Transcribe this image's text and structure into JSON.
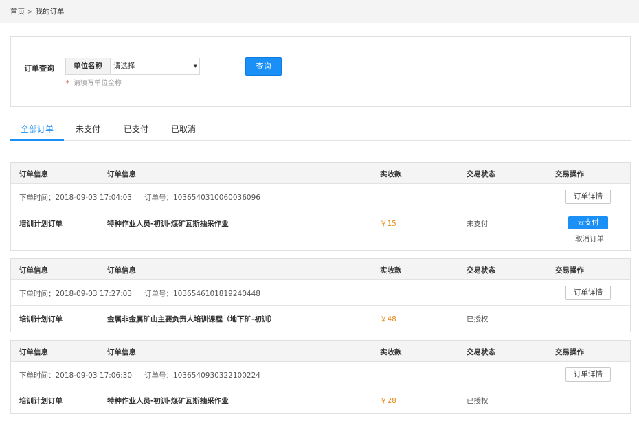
{
  "breadcrumb": {
    "home": "首页",
    "separator": ">",
    "current": "我的订单"
  },
  "search": {
    "label": "订单查询",
    "prefix": "单位名称",
    "select_value": "请选择",
    "hint_star": "*",
    "hint": "请填写单位全称",
    "button": "查询"
  },
  "tabs": [
    "全部订单",
    "未支付",
    "已支付",
    "已取消"
  ],
  "columns": {
    "col1": "订单信息",
    "col2": "订单信息",
    "col3": "实收款",
    "col4": "交易状态",
    "col5": "交易操作"
  },
  "orders": [
    {
      "time_label": "下单时间：2018-09-03 17:04:03",
      "no_label": "订单号：1036540310060036096",
      "detail_button": "订单详情",
      "type": "培训计划订单",
      "name": "特种作业人员-初训-煤矿瓦斯抽采作业",
      "price": "￥15",
      "status": "未支付",
      "pay_button": "去支付",
      "cancel_link": "取消订单"
    },
    {
      "time_label": "下单时间：2018-09-03 17:27:03",
      "no_label": "订单号：1036546101819240448",
      "detail_button": "订单详情",
      "type": "培训计划订单",
      "name": "金属非金属矿山主要负责人培训课程（地下矿-初训）",
      "price": "￥48",
      "status": "已授权"
    },
    {
      "time_label": "下单时间：2018-09-03 17:06:30",
      "no_label": "订单号：1036540930322100224",
      "detail_button": "订单详情",
      "type": "培训计划订单",
      "name": "特种作业人员-初训-煤矿瓦斯抽采作业",
      "price": "￥28",
      "status": "已授权"
    }
  ],
  "colors": {
    "accent": "#1a8ff5",
    "price": "#e88a18",
    "star": "#e23b3b"
  }
}
